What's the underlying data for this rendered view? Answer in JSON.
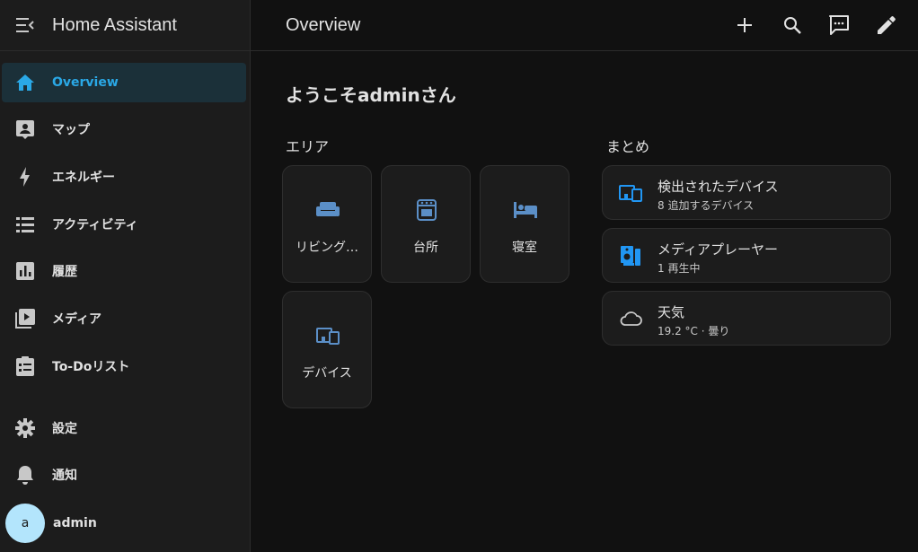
{
  "app": {
    "title": "Home Assistant"
  },
  "sidebar": {
    "items": [
      {
        "label": "Overview",
        "icon": "home-icon",
        "active": true
      },
      {
        "label": "マップ",
        "icon": "map-icon"
      },
      {
        "label": "エネルギー",
        "icon": "lightning-icon"
      },
      {
        "label": "アクティビティ",
        "icon": "list-icon"
      },
      {
        "label": "履歴",
        "icon": "chart-icon"
      },
      {
        "label": "メディア",
        "icon": "media-icon"
      },
      {
        "label": "To-Doリスト",
        "icon": "clipboard-icon"
      },
      {
        "label": "設定",
        "icon": "gear-icon"
      },
      {
        "label": "通知",
        "icon": "bell-icon"
      }
    ],
    "user": {
      "initial": "a",
      "name": "admin"
    }
  },
  "topbar": {
    "title": "Overview",
    "actions": [
      "add-icon",
      "search-icon",
      "assist-icon",
      "edit-icon"
    ]
  },
  "main": {
    "welcome": "ようこそadminさん",
    "areas_title": "エリア",
    "summary_title": "まとめ",
    "areas": [
      {
        "label": "リビング…",
        "icon": "sofa-icon"
      },
      {
        "label": "台所",
        "icon": "stove-icon"
      },
      {
        "label": "寝室",
        "icon": "bed-icon"
      },
      {
        "label": "デバイス",
        "icon": "devices-icon"
      }
    ],
    "summaries": [
      {
        "title": "検出されたデバイス",
        "subtitle": "8 追加するデバイス",
        "icon": "devices-icon"
      },
      {
        "title": "メディアプレーヤー",
        "subtitle": "1 再生中",
        "icon": "speaker-icon"
      },
      {
        "title": "天気",
        "subtitle": "19.2 °C · 曇り",
        "icon": "cloud-icon"
      }
    ]
  },
  "colors": {
    "accent": "#2aa8e6",
    "area_icon": "#5b8fc7",
    "summary_icon": "#2196f3",
    "avatar_bg": "#b3e5fc"
  }
}
